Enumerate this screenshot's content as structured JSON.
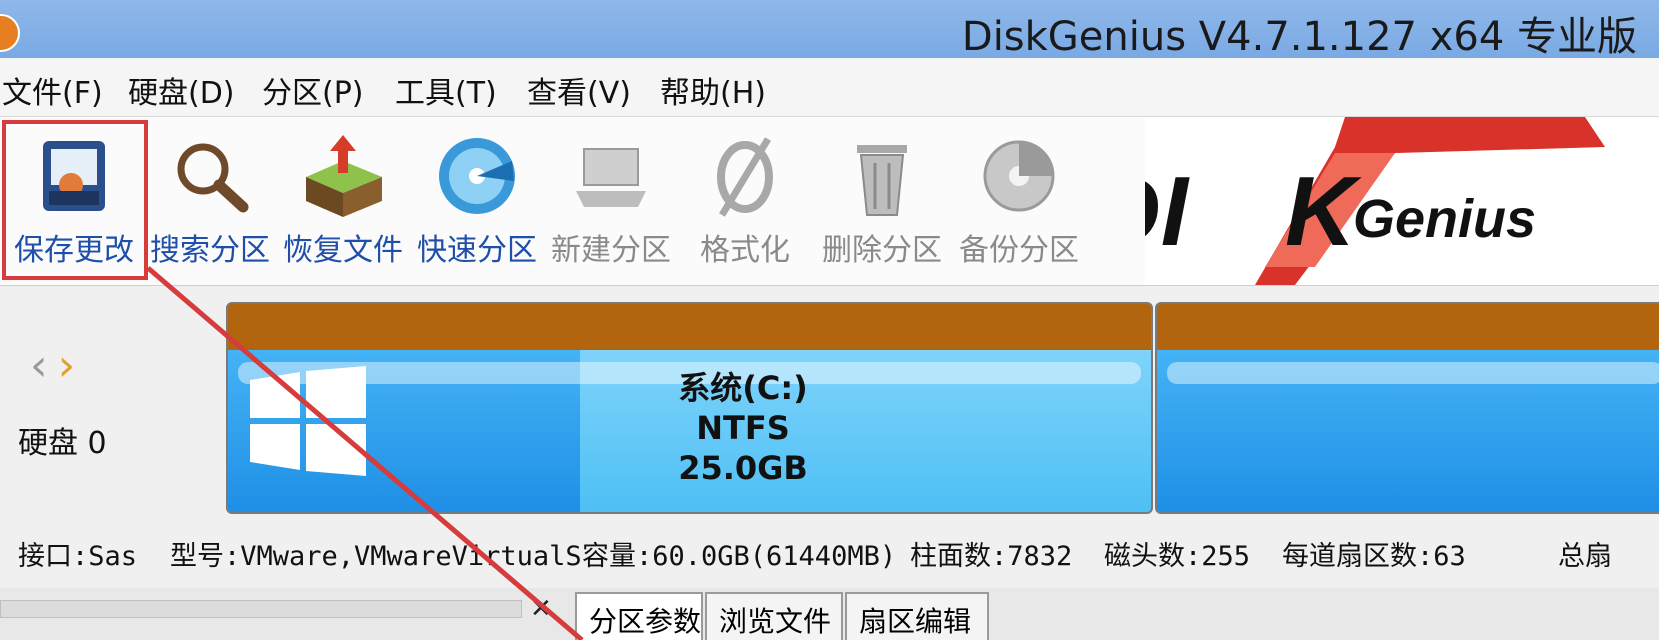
{
  "window": {
    "title": "DiskGenius V4.7.1.127 x64 专业版"
  },
  "menu": [
    {
      "label": "文件(F)"
    },
    {
      "label": "硬盘(D)"
    },
    {
      "label": "分区(P)"
    },
    {
      "label": "工具(T)"
    },
    {
      "label": "查看(V)"
    },
    {
      "label": "帮助(H)"
    }
  ],
  "toolbar": [
    {
      "label": "保存更改",
      "icon": "save-icon",
      "enabled": true
    },
    {
      "label": "搜索分区",
      "icon": "search-icon",
      "enabled": true
    },
    {
      "label": "恢复文件",
      "icon": "recover-icon",
      "enabled": true
    },
    {
      "label": "快速分区",
      "icon": "quick-partition-icon",
      "enabled": true
    },
    {
      "label": "新建分区",
      "icon": "new-partition-icon",
      "enabled": false
    },
    {
      "label": "格式化",
      "icon": "format-icon",
      "enabled": false
    },
    {
      "label": "删除分区",
      "icon": "delete-icon",
      "enabled": false
    },
    {
      "label": "备份分区",
      "icon": "backup-icon",
      "enabled": false
    }
  ],
  "logo": {
    "text_left": "DI",
    "text_mid": "K",
    "text_right": "Genius"
  },
  "left_panel": {
    "disk_label": "硬盘 0"
  },
  "partition": {
    "name": "系统(C:)",
    "fs": "NTFS",
    "size": "25.0GB"
  },
  "disk_info": {
    "interface": "接口:Sas",
    "model": "型号:VMware,VMwareVirtualS",
    "capacity": "容量:60.0GB(61440MB)",
    "cylinders": "柱面数:7832",
    "heads": "磁头数:255",
    "sectors": "每道扇区数:63",
    "total": "总扇"
  },
  "tabs": [
    {
      "label": "分区参数"
    },
    {
      "label": "浏览文件"
    },
    {
      "label": "扇区编辑"
    }
  ],
  "colors": {
    "title_bar": "#7aa9e3",
    "partition_header": "#b2640f",
    "partition_body": "#39a8f0",
    "highlight": "#d63c3c",
    "tool_label": "#1f4fa8"
  }
}
